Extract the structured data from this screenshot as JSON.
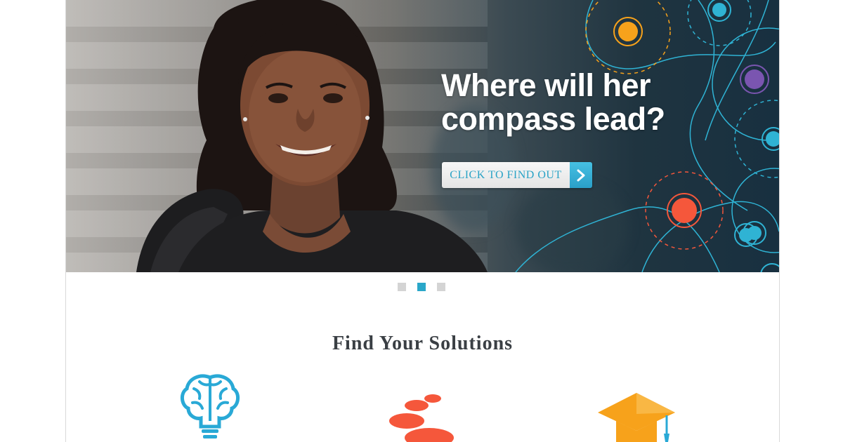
{
  "hero": {
    "headline_line1": "Where will her",
    "headline_line2": "compass lead?",
    "cta_label": "CLICK TO FIND OUT"
  },
  "carousel": {
    "slides": 3,
    "active_index": 1
  },
  "solutions": {
    "title": "Find Your Solutions",
    "items": [
      {
        "icon": "brain-lightbulb-icon",
        "color": "#29a9d6"
      },
      {
        "icon": "stepping-stones-icon",
        "color": "#f5573b"
      },
      {
        "icon": "graduation-cap-icon",
        "color": "#f7a21b"
      }
    ]
  },
  "colors": {
    "accent_blue": "#2aa7c9",
    "accent_orange": "#f5573b",
    "accent_yellow": "#f7a21b",
    "accent_purple": "#7a55b0"
  }
}
